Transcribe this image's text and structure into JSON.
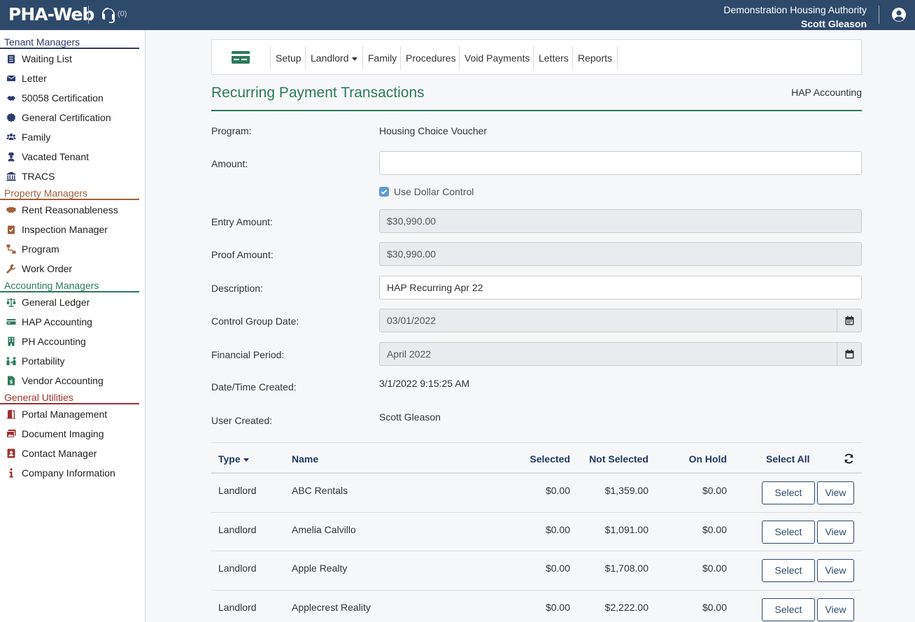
{
  "header": {
    "logo": "PHA-Web",
    "support_count": "(0)",
    "org_name": "Demonstration Housing Authority",
    "user_name": "Scott Gleason"
  },
  "sidebar": {
    "sections": [
      {
        "title": "Tenant Managers",
        "items": [
          "Waiting List",
          "Letter",
          "50058 Certification",
          "General Certification",
          "Family",
          "Vacated Tenant",
          "TRACS"
        ]
      },
      {
        "title": "Property Managers",
        "items": [
          "Rent Reasonableness",
          "Inspection Manager",
          "Program",
          "Work Order"
        ]
      },
      {
        "title": "Accounting Managers",
        "items": [
          "General Ledger",
          "HAP Accounting",
          "PH Accounting",
          "Portability",
          "Vendor Accounting"
        ]
      },
      {
        "title": "General Utilities",
        "items": [
          "Portal Management",
          "Document Imaging",
          "Contact Manager",
          "Company Information"
        ]
      }
    ]
  },
  "toolbar": {
    "items": [
      "Setup",
      "Landlord",
      "Family",
      "Procedures",
      "Void Payments",
      "Letters",
      "Reports"
    ]
  },
  "page": {
    "title": "Recurring Payment Transactions",
    "subtitle": "HAP Accounting"
  },
  "form": {
    "program_label": "Program:",
    "program_value": "Housing Choice Voucher",
    "amount_label": "Amount:",
    "amount_value": "",
    "dollar_control_label": "Use Dollar Control",
    "entry_amount_label": "Entry Amount:",
    "entry_amount_value": "$30,990.00",
    "proof_amount_label": "Proof Amount:",
    "proof_amount_value": "$30,990.00",
    "description_label": "Description:",
    "description_value": "HAP Recurring Apr 22",
    "control_date_label": "Control Group Date:",
    "control_date_value": "03/01/2022",
    "financial_period_label": "Financial Period:",
    "financial_period_value": "April 2022",
    "created_label": "Date/Time Created:",
    "created_value": "3/1/2022 9:15:25 AM",
    "user_created_label": "User Created:",
    "user_created_value": "Scott Gleason"
  },
  "table": {
    "headers": {
      "type": "Type",
      "name": "Name",
      "selected": "Selected",
      "not_selected": "Not Selected",
      "on_hold": "On Hold",
      "select_all": "Select All"
    },
    "select_label": "Select",
    "view_label": "View",
    "rows": [
      {
        "type": "Landlord",
        "name": "ABC Rentals",
        "selected": "$0.00",
        "not_selected": "$1,359.00",
        "on_hold": "$0.00"
      },
      {
        "type": "Landlord",
        "name": "Amelia Calvillo",
        "selected": "$0.00",
        "not_selected": "$1,091.00",
        "on_hold": "$0.00"
      },
      {
        "type": "Landlord",
        "name": "Apple Realty",
        "selected": "$0.00",
        "not_selected": "$1,708.00",
        "on_hold": "$0.00"
      },
      {
        "type": "Landlord",
        "name": "Applecrest Reality",
        "selected": "$0.00",
        "not_selected": "$2,222.00",
        "on_hold": "$0.00"
      }
    ]
  }
}
